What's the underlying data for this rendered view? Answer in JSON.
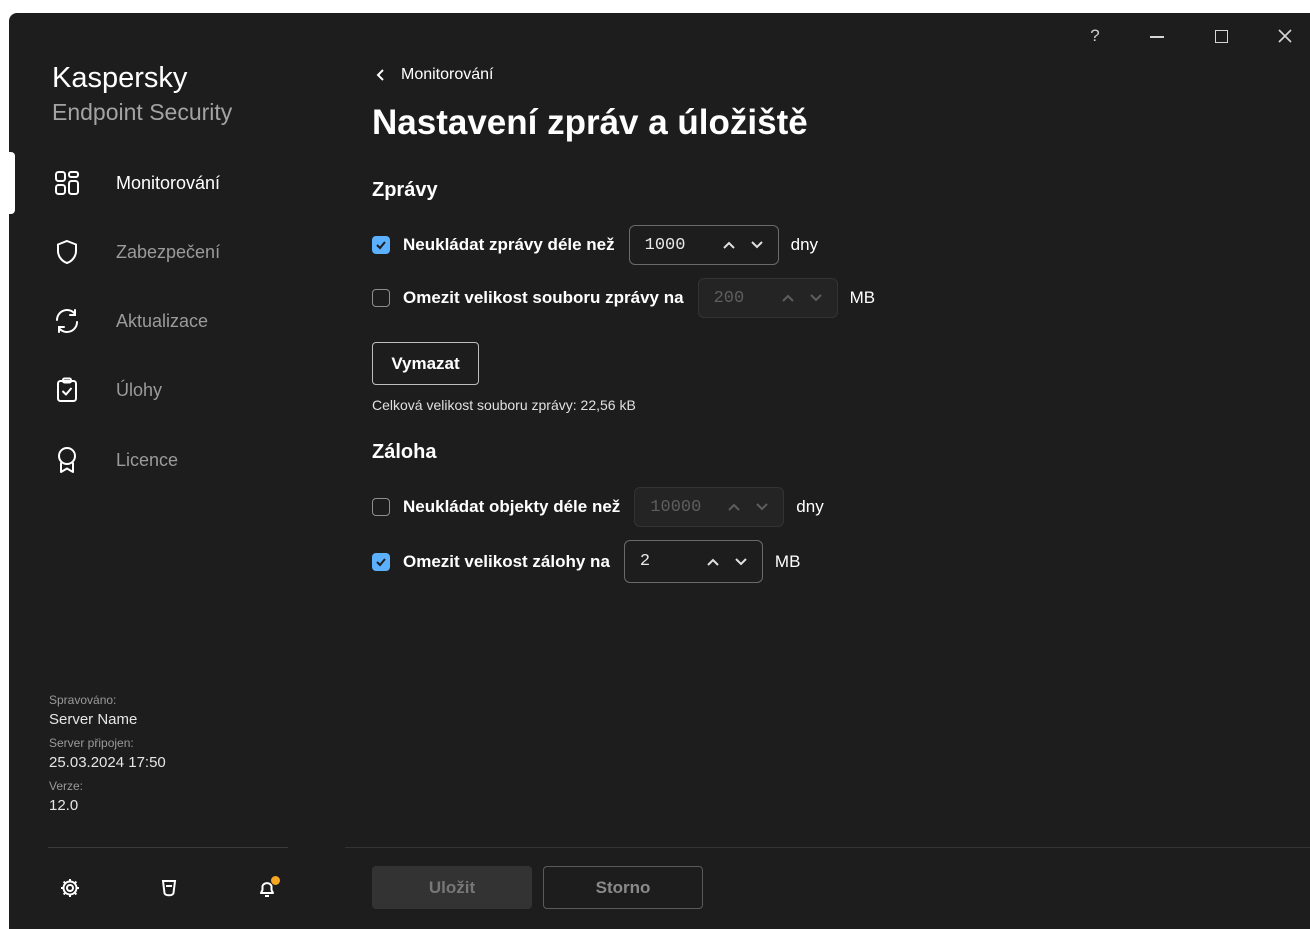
{
  "window": {
    "help_label": "?"
  },
  "brand": {
    "name": "Kaspersky",
    "product": "Endpoint Security"
  },
  "nav": {
    "items": [
      {
        "label": "Monitorování",
        "icon": "dashboard-icon"
      },
      {
        "label": "Zabezpečení",
        "icon": "shield-icon"
      },
      {
        "label": "Aktualizace",
        "icon": "refresh-icon"
      },
      {
        "label": "Úlohy",
        "icon": "clipboard-check-icon"
      },
      {
        "label": "Licence",
        "icon": "award-icon"
      }
    ],
    "active": "Monitorování"
  },
  "managed": {
    "label": "Spravováno:",
    "server": "Server Name",
    "connected_label": "Server připojen:",
    "connected": "25.03.2024 17:50",
    "version_label": "Verze:",
    "version": "12.0"
  },
  "breadcrumb": {
    "back_label": "Monitorování"
  },
  "page": {
    "title": "Nastavení zpráv a úložiště"
  },
  "reports": {
    "title": "Zprávy",
    "keep": {
      "label": "Neukládat zprávy déle než",
      "checked": true,
      "value": "1000",
      "unit": "dny"
    },
    "limit": {
      "label": "Omezit velikost souboru zprávy na",
      "checked": false,
      "value": "200",
      "unit": "MB"
    },
    "clear_label": "Vymazat",
    "total_size": "Celková velikost souboru zprávy: 22,56 kB"
  },
  "backup": {
    "title": "Záloha",
    "keep": {
      "label": "Neukládat objekty déle než",
      "checked": false,
      "value": "10000",
      "unit": "dny"
    },
    "limit": {
      "label": "Omezit velikost zálohy na",
      "checked": true,
      "value": "2",
      "unit": "MB"
    }
  },
  "footer": {
    "save_label": "Uložit",
    "cancel_label": "Storno"
  },
  "colors": {
    "accent": "#5bb0ff",
    "notification_dot": "#f5a623",
    "background": "#1d1d1d"
  }
}
